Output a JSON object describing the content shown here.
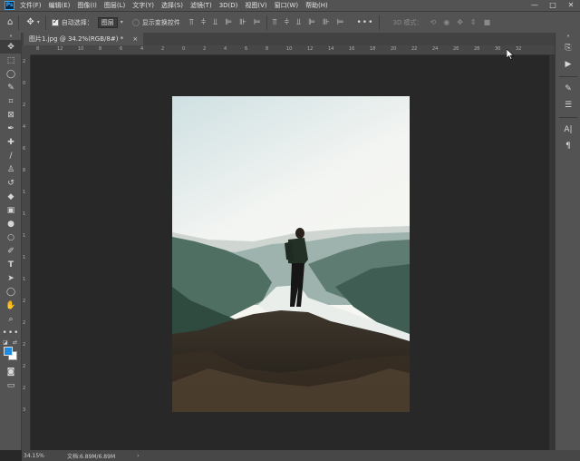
{
  "app": {
    "logo_text": "Ps",
    "menu": [
      "文件(F)",
      "编辑(E)",
      "图像(I)",
      "图层(L)",
      "文字(Y)",
      "选择(S)",
      "滤镜(T)",
      "3D(D)",
      "视图(V)",
      "窗口(W)",
      "帮助(H)"
    ]
  },
  "options_bar": {
    "auto_select_label": "自动选择：",
    "auto_select_value": "图层",
    "show_transform_label": "显示变换控件",
    "more_label": "•••",
    "mode_3d_label": "3D 模式："
  },
  "document": {
    "tab_title": "图片1.jpg @ 34.2%(RGB/8#) *",
    "close_glyph": "×"
  },
  "ruler_top": [
    "8",
    "12",
    "10",
    "8",
    "6",
    "4",
    "2",
    "0",
    "2",
    "4",
    "6",
    "8",
    "10",
    "12",
    "14",
    "16",
    "18",
    "20",
    "22",
    "24",
    "26",
    "28",
    "30",
    "32"
  ],
  "ruler_left": [
    "2",
    "0",
    "2",
    "4",
    "6",
    "8",
    "1",
    "1",
    "1",
    "1",
    "1",
    "2",
    "2",
    "2",
    "2",
    "2",
    "3"
  ],
  "status": {
    "zoom": "34.15%",
    "doc_size": "文档:6.89M/6.89M",
    "arrow": "›"
  },
  "colors": {
    "foreground": "#1e8be0",
    "background": "#ffffff",
    "accent": "#31a8ff"
  },
  "icons": {
    "toolbar": [
      "move-icon",
      "marquee-icon",
      "lasso-icon",
      "quick-select-icon",
      "crop-icon",
      "frame-icon",
      "eyedropper-icon",
      "healing-icon",
      "brush-icon",
      "stamp-icon",
      "history-brush-icon",
      "eraser-icon",
      "gradient-icon",
      "blur-icon",
      "dodge-icon",
      "pen-icon",
      "type-icon",
      "path-select-icon",
      "shape-icon",
      "hand-icon",
      "zoom-icon",
      "more-tools-icon"
    ],
    "right_panel": [
      "history-icon",
      "play-icon",
      "brush-settings-icon",
      "properties-icon",
      "character-icon",
      "paragraph-icon"
    ]
  }
}
